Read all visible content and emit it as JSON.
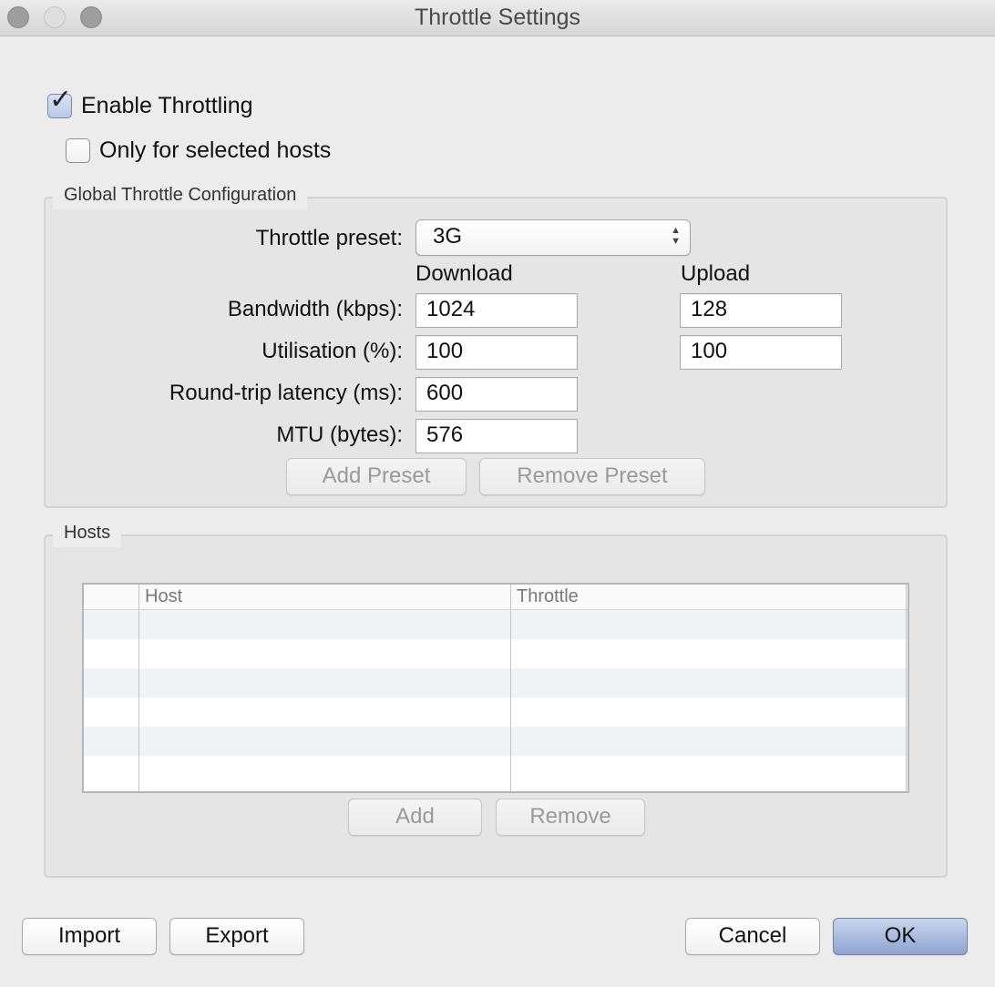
{
  "window": {
    "title": "Throttle Settings"
  },
  "options": {
    "enable_throttling": {
      "label": "Enable Throttling",
      "checked": true
    },
    "only_selected_hosts": {
      "label": "Only for selected hosts",
      "checked": false
    }
  },
  "global_config": {
    "title": "Global Throttle Configuration",
    "preset_label": "Throttle preset:",
    "preset_value": "3G",
    "download_header": "Download",
    "upload_header": "Upload",
    "bandwidth_label": "Bandwidth (kbps):",
    "bandwidth_download": "1024",
    "bandwidth_upload": "128",
    "utilisation_label": "Utilisation (%):",
    "utilisation_download": "100",
    "utilisation_upload": "100",
    "latency_label": "Round-trip latency (ms):",
    "latency_value": "600",
    "mtu_label": "MTU (bytes):",
    "mtu_value": "576",
    "add_preset_label": "Add Preset",
    "remove_preset_label": "Remove Preset"
  },
  "hosts": {
    "title": "Hosts",
    "columns": [
      "",
      "Host",
      "Throttle"
    ],
    "rows": [],
    "add_label": "Add",
    "remove_label": "Remove"
  },
  "footer": {
    "import_label": "Import",
    "export_label": "Export",
    "cancel_label": "Cancel",
    "ok_label": "OK"
  }
}
